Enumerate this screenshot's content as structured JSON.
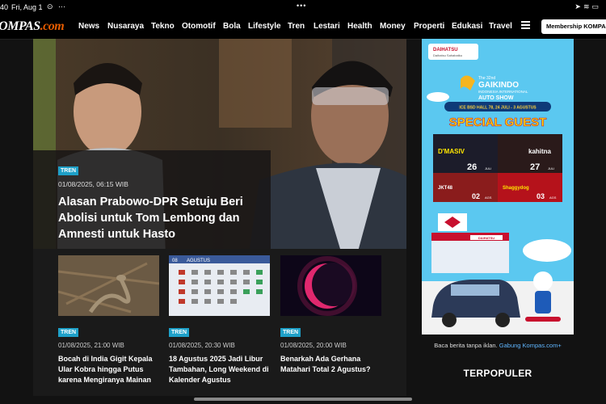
{
  "status_bar": {
    "time": "40",
    "date": "Fri, Aug 1",
    "dots": "•••"
  },
  "header": {
    "logo_text": "KOMPAS",
    "logo_suffix": ".com",
    "nav": [
      "News",
      "Nusaraya",
      "Tekno",
      "Otomotif",
      "Bola",
      "Lifestyle",
      "Tren",
      "Lestari",
      "Health",
      "Money",
      "Properti",
      "Edukasi",
      "Travel"
    ],
    "membership_label": "Membership KOMPAS.com"
  },
  "hero": {
    "tag": "TREN",
    "date": "01/08/2025, 06:15 WIB",
    "title": "Alasan Prabowo-DPR Setuju Beri Abolisi untuk Tom Lembong dan Amnesti untuk Hasto"
  },
  "cards": [
    {
      "tag": "TREN",
      "date": "01/08/2025, 21:00 WIB",
      "title": "Bocah di India Gigit Kepala Ular Kobra hingga Putus karena Mengiranya Mainan"
    },
    {
      "tag": "TREN",
      "date": "01/08/2025, 20:30 WIB",
      "title": "18 Agustus 2025 Jadi Libur Tambahan, Long Weekend di Kalender Agustus"
    },
    {
      "tag": "TREN",
      "date": "01/08/2025, 20:00 WIB",
      "title": "Benarkah Ada Gerhana Matahari Total 2 Agustus?"
    }
  ],
  "calendar_thumb": {
    "month_label": "AGUSTUS",
    "number_label": "08"
  },
  "ad": {
    "brand": "DAIHATSU",
    "brand_sub": "Daihatsu Sahabatku",
    "event_top": "The 32nd",
    "event_name": "GAIKINDO",
    "event_sub": "INDONESIA INTERNATIONAL",
    "event_show": "AUTO SHOW",
    "venue": "ICE BSD HALL 78, 24 JULI - 3 AGUSTUS",
    "special": "SPECIAL GUEST",
    "guests": [
      {
        "name": "D'MASIV",
        "day": "26",
        "month": "JULI"
      },
      {
        "name": "kahitna",
        "day": "27",
        "month": "JULI"
      },
      {
        "name": "JKT48",
        "day": "02",
        "month": "AGS"
      },
      {
        "name": "Shaggydog",
        "day": "03",
        "month": "AGS"
      }
    ],
    "showroom_label": "DAIHATSU",
    "note": "Baca berita tanpa iklan.",
    "note_link": "Gabung Kompas.com+"
  },
  "sidebar": {
    "popular_title": "TERPOPULER"
  },
  "colors": {
    "tag": "#1ea0c8",
    "accent_logo": "#e65c00",
    "ad_bg": "#5bc8f0",
    "link": "#5fb6ff"
  }
}
